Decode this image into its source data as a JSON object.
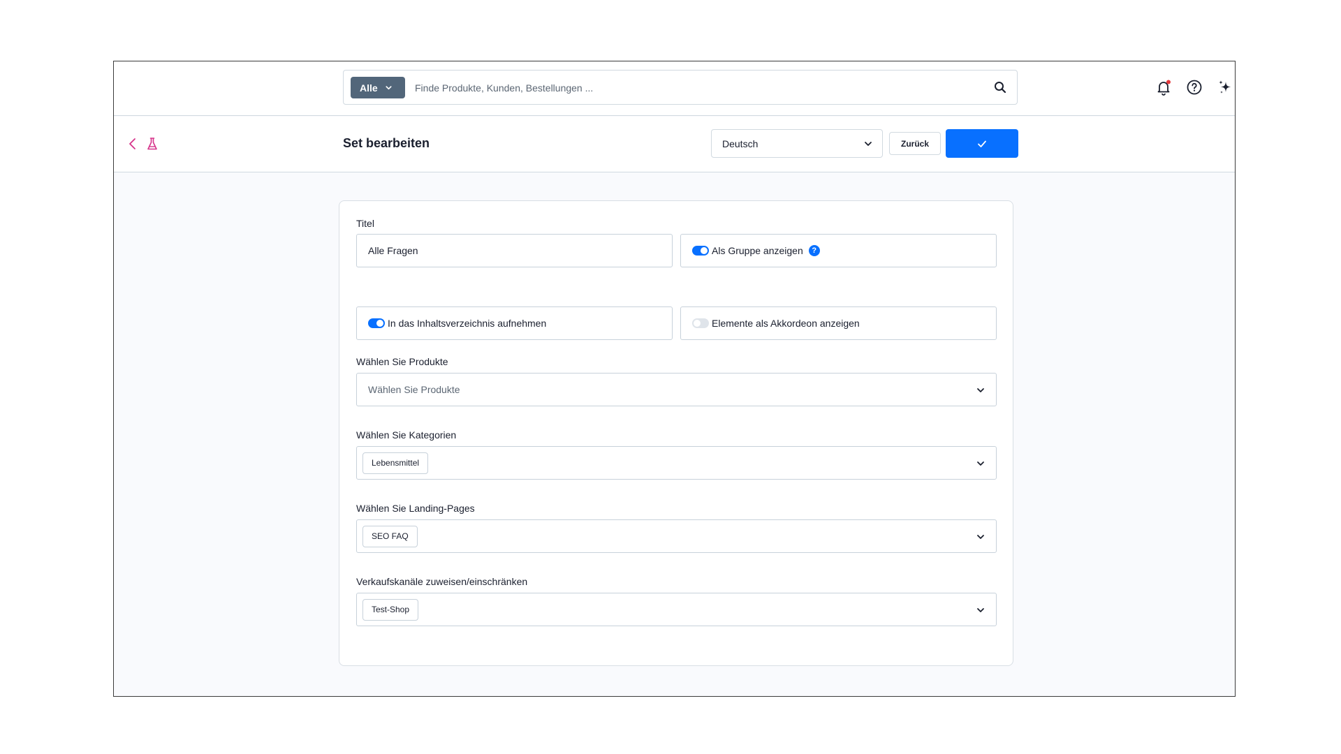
{
  "search": {
    "filter_label": "Alle",
    "placeholder": "Finde Produkte, Kunden, Bestellungen ..."
  },
  "header": {
    "title": "Set bearbeiten",
    "language": "Deutsch",
    "back_label": "Zurück"
  },
  "form": {
    "title_label": "Titel",
    "title_value": "Alle Fragen",
    "show_as_group_label": "Als Gruppe anzeigen",
    "show_as_group_help": "?",
    "toc_label": "In das Inhaltsverzeichnis aufnehmen",
    "accordion_label": "Elemente als Akkordeon anzeigen",
    "products_label": "Wählen Sie Produkte",
    "products_placeholder": "Wählen Sie Produkte",
    "categories_label": "Wählen Sie Kategorien",
    "categories_tag": "Lebensmittel",
    "landing_label": "Wählen Sie Landing-Pages",
    "landing_tag": "SEO FAQ",
    "channels_label": "Verkaufskanäle zuweisen/einschränken",
    "channels_tag": "Test-Shop"
  },
  "colors": {
    "accent": "#0870ff",
    "filter_bg": "#52667a",
    "back_icon": "#d6338a",
    "notification_dot": "#e5383b"
  },
  "icons": [
    "search-icon",
    "bell-icon",
    "help-circle-icon",
    "sparkle-icon",
    "chevron-left-icon",
    "flask-icon",
    "checkmark-icon",
    "chevron-down-icon"
  ]
}
